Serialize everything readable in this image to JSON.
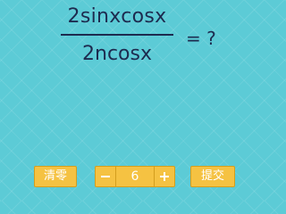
{
  "question": {
    "numerator": "2sinxcosx",
    "denominator": "2ncosx",
    "equals_text": "= ?"
  },
  "controls": {
    "clear_label": "清零",
    "stepper_value": "6",
    "submit_label": "提交"
  },
  "colors": {
    "background": "#5ccbd6",
    "button": "#f5c242",
    "button_border": "#d39e1e",
    "text": "#1d2b4f"
  },
  "icons": {
    "decrement": "minus-icon",
    "increment": "plus-icon"
  }
}
